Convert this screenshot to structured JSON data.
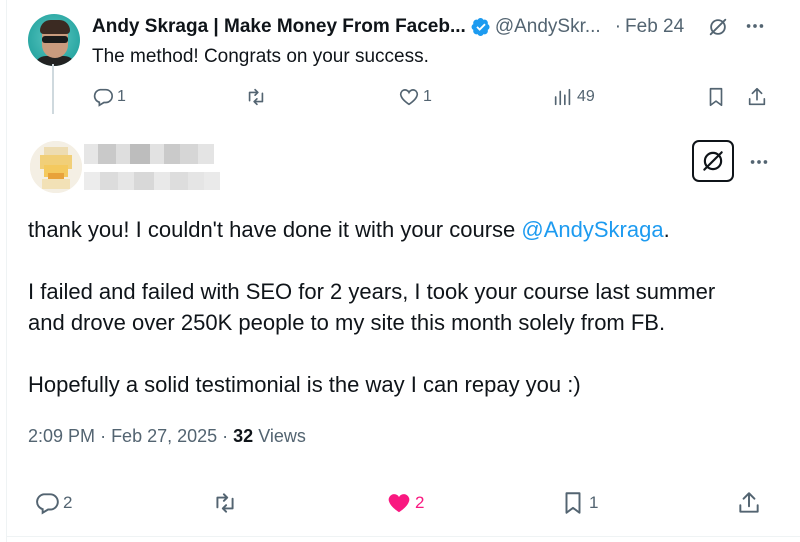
{
  "parent_tweet": {
    "author_name": "Andy Skraga | Make Money From Faceb...",
    "handle": "@AndySkr...",
    "date": "Feb 24",
    "text": "The method! Congrats on your success.",
    "replies": "1",
    "reposts": "",
    "likes": "1",
    "views": "49"
  },
  "main_tweet": {
    "author_name": "",
    "handle": "",
    "text_line1_before": "thank you! I couldn't have done it with your course ",
    "text_line1_mention": "@AndySkraga",
    "text_line1_after": ".",
    "text_line2": "I failed and failed with SEO for 2 years, I took your course last summer",
    "text_line3": "and drove over 250K people to my site this month solely from FB.",
    "text_line4": "Hopefully a solid testimonial is the way I can repay you :)",
    "time": "2:09 PM",
    "date": "Feb 27, 2025",
    "views_count": "32",
    "views_label": "Views",
    "replies": "2",
    "reposts": "",
    "likes": "2",
    "bookmarks": "1"
  },
  "colors": {
    "text": "#0f1419",
    "secondary": "#536471",
    "link": "#1d9bf0",
    "like_active": "#f91880",
    "verified": "#1d9bf0"
  },
  "icons": [
    "verified-badge-icon",
    "grok-icon",
    "more-icon",
    "reply-icon",
    "repost-icon",
    "like-icon",
    "views-icon",
    "bookmark-icon",
    "share-icon"
  ]
}
